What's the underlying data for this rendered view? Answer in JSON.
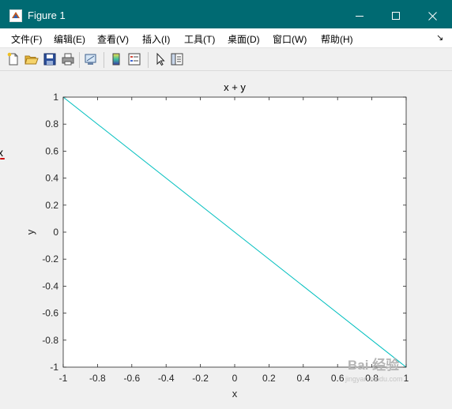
{
  "window": {
    "title": "Figure 1",
    "titlebar_color": "#006a72"
  },
  "menu": {
    "items": [
      {
        "label": "文件(F)"
      },
      {
        "label": "编辑(E)"
      },
      {
        "label": "查看(V)"
      },
      {
        "label": "插入(I)"
      },
      {
        "label": "工具(T)"
      },
      {
        "label": "桌面(D)"
      },
      {
        "label": "窗口(W)"
      },
      {
        "label": "帮助(H)"
      }
    ]
  },
  "toolbar": {
    "buttons": [
      {
        "icon": "new-file-icon"
      },
      {
        "icon": "open-folder-icon"
      },
      {
        "icon": "save-icon"
      },
      {
        "icon": "print-icon"
      },
      {
        "icon": "link-plot-icon"
      },
      {
        "icon": "colorbar-icon"
      },
      {
        "icon": "legend-icon"
      },
      {
        "icon": "pointer-icon"
      },
      {
        "icon": "property-inspector-icon"
      }
    ]
  },
  "chart_data": {
    "type": "line",
    "title": "x + y",
    "xlabel": "x",
    "ylabel": "y",
    "xlim": [
      -1,
      1
    ],
    "ylim": [
      -1,
      1
    ],
    "x_ticks": [
      -1,
      -0.8,
      -0.6,
      -0.4,
      -0.2,
      0,
      0.2,
      0.4,
      0.6,
      0.8,
      1
    ],
    "y_ticks": [
      -1,
      -0.8,
      -0.6,
      -0.4,
      -0.2,
      0,
      0.2,
      0.4,
      0.6,
      0.8,
      1
    ],
    "grid": false,
    "series": [
      {
        "x": [
          -1,
          1
        ],
        "y": [
          1,
          -1
        ],
        "color": "#00bfbf"
      }
    ]
  },
  "watermark": {
    "text": "Bai 经验",
    "sub": "jingyan.baidu.com"
  }
}
